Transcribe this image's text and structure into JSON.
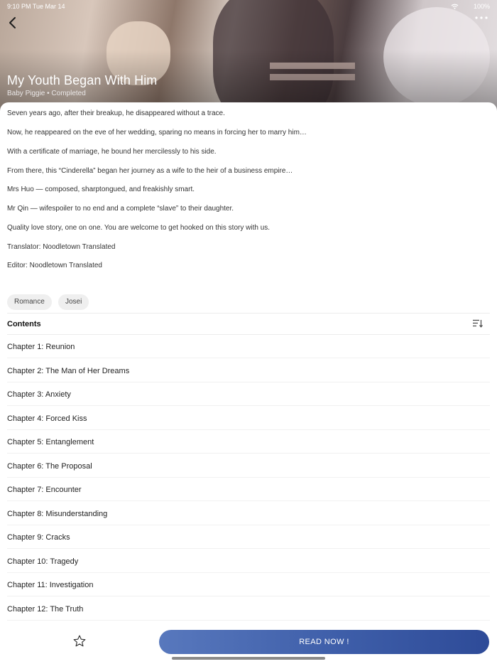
{
  "status_bar": {
    "time": "9:10 PM   Tue Mar 14",
    "battery": "100%"
  },
  "header": {
    "title": "My Youth Began With Him",
    "meta": "Baby Piggie • Completed",
    "back_icon": "chevron-left-icon",
    "more_icon": "ellipsis-icon"
  },
  "description": [
    "Seven years ago, after their breakup, he disappeared without a trace.",
    "Now, he reappeared on the eve of her wedding, sparing no means in forcing her to marry him…",
    "With a certificate of marriage, he bound her mercilessly to his side.",
    "From there, this “Cinderella” began her journey as a wife to the heir of a business empire…",
    "Mrs Huo — composed, sharptongued, and freakishly smart.",
    "Mr Qin — wifespoiler to no end and a complete “slave” to their daughter.",
    "Quality love story, one on one. You are welcome to get hooked on this story with us.",
    "Translator: Noodletown Translated",
    "Editor: Noodletown Translated"
  ],
  "tags": [
    "Romance",
    "Josei"
  ],
  "contents": {
    "title": "Contents",
    "sort_icon": "sort-order-icon",
    "chapters": [
      "Chapter 1: Reunion",
      "Chapter 2: The Man of Her Dreams",
      "Chapter 3: Anxiety",
      "Chapter 4: Forced Kiss",
      "Chapter 5: Entanglement",
      "Chapter 6: The Proposal",
      "Chapter 7: Encounter",
      "Chapter 8: Misunderstanding",
      "Chapter 9: Cracks",
      "Chapter 10: Tragedy",
      "Chapter 11: Investigation",
      "Chapter 12: The Truth"
    ]
  },
  "bottom_bar": {
    "read_label": "READ NOW !",
    "star_icon": "star-outline-icon"
  },
  "colors": {
    "read_button": "#3e5ea9",
    "tag_bg": "#efefef"
  }
}
